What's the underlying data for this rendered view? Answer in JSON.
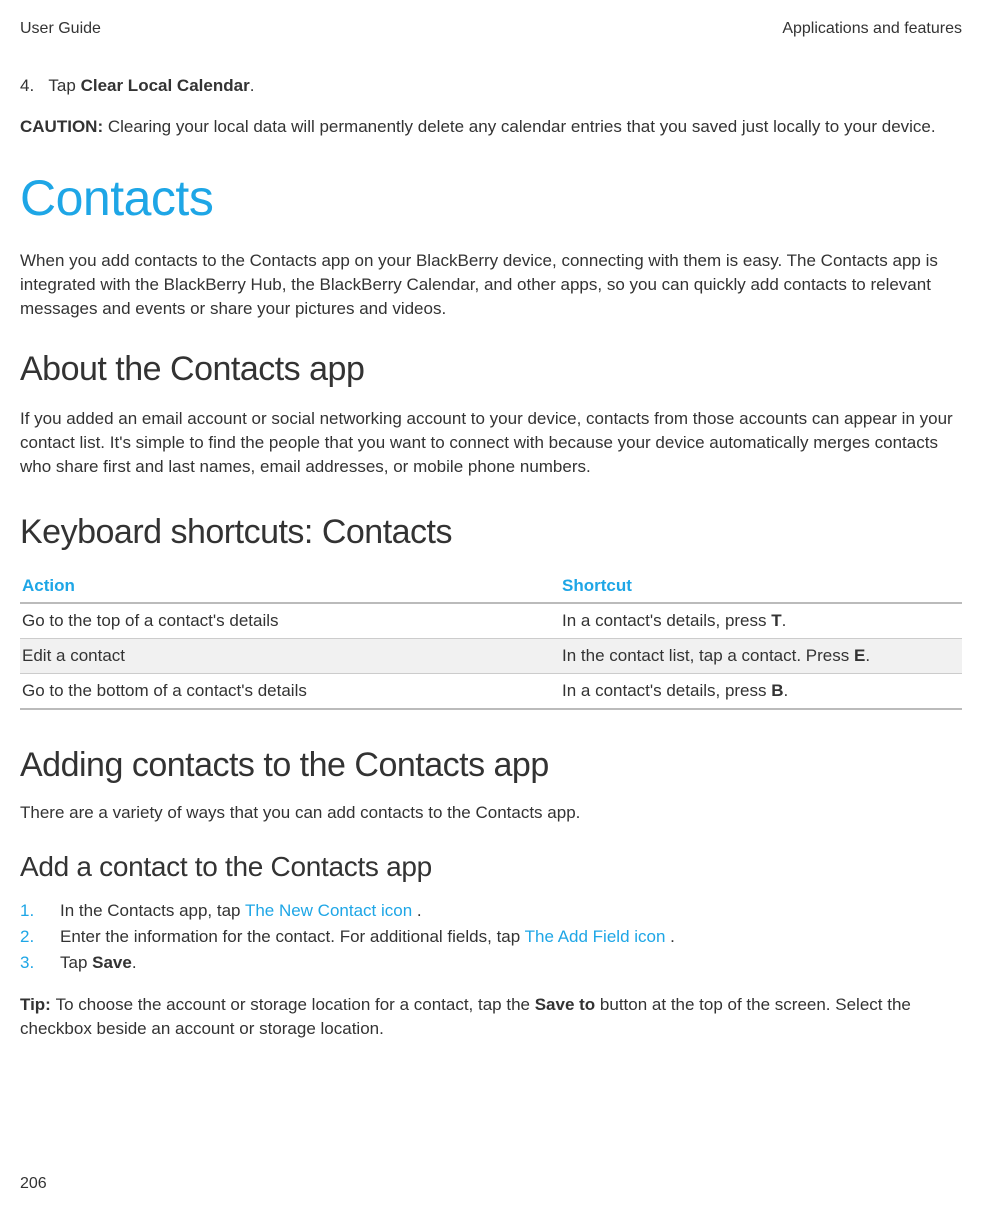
{
  "header": {
    "left": "User Guide",
    "right": "Applications and features"
  },
  "step4": {
    "num": "4.",
    "prefix": "Tap ",
    "bold": "Clear Local Calendar",
    "suffix": "."
  },
  "caution": {
    "label": "CAUTION: ",
    "text": "Clearing your local data will permanently delete any calendar entries that you saved just locally to your device."
  },
  "h1": "Contacts",
  "intro": "When you add contacts to the Contacts app on your BlackBerry device, connecting with them is easy. The Contacts app is integrated with the BlackBerry Hub, the BlackBerry Calendar, and other apps, so you can quickly add contacts to relevant messages and events or share your pictures and videos.",
  "h2_about": "About the Contacts app",
  "about_text": "If you added an email account or social networking account to your device, contacts from those accounts can appear in your contact list. It's simple to find the people that you want to connect with because your device automatically merges contacts who share first and last names, email addresses, or mobile phone numbers.",
  "h2_shortcuts": "Keyboard shortcuts: Contacts",
  "table": {
    "head": {
      "action": "Action",
      "shortcut": "Shortcut"
    },
    "rows": [
      {
        "action": "Go to the top of a contact's details",
        "pre": "In a contact's details, press ",
        "key": "T",
        "post": "."
      },
      {
        "action": "Edit a contact",
        "pre": "In the contact list, tap a contact. Press ",
        "key": "E",
        "post": "."
      },
      {
        "action": "Go to the bottom of a contact's details",
        "pre": "In a contact's details, press ",
        "key": "B",
        "post": "."
      }
    ]
  },
  "h2_adding": "Adding contacts to the Contacts app",
  "adding_sub": "There are a variety of ways that you can add contacts to the Contacts app.",
  "h3_add": "Add a contact to the Contacts app",
  "steps": [
    {
      "num": "1.",
      "pre": "In the Contacts app, tap ",
      "icon": " The New Contact icon ",
      "post": "."
    },
    {
      "num": "2.",
      "pre": "Enter the information for the contact. For additional fields, tap ",
      "icon": " The Add Field icon ",
      "post": "."
    },
    {
      "num": "3.",
      "pre": "Tap ",
      "bold": "Save",
      "post": "."
    }
  ],
  "tip": {
    "label": "Tip: ",
    "pre": "To choose the account or storage location for a contact, tap the ",
    "bold": "Save to",
    "post": " button at the top of the screen. Select the checkbox beside an account or storage location."
  },
  "page_num": "206"
}
